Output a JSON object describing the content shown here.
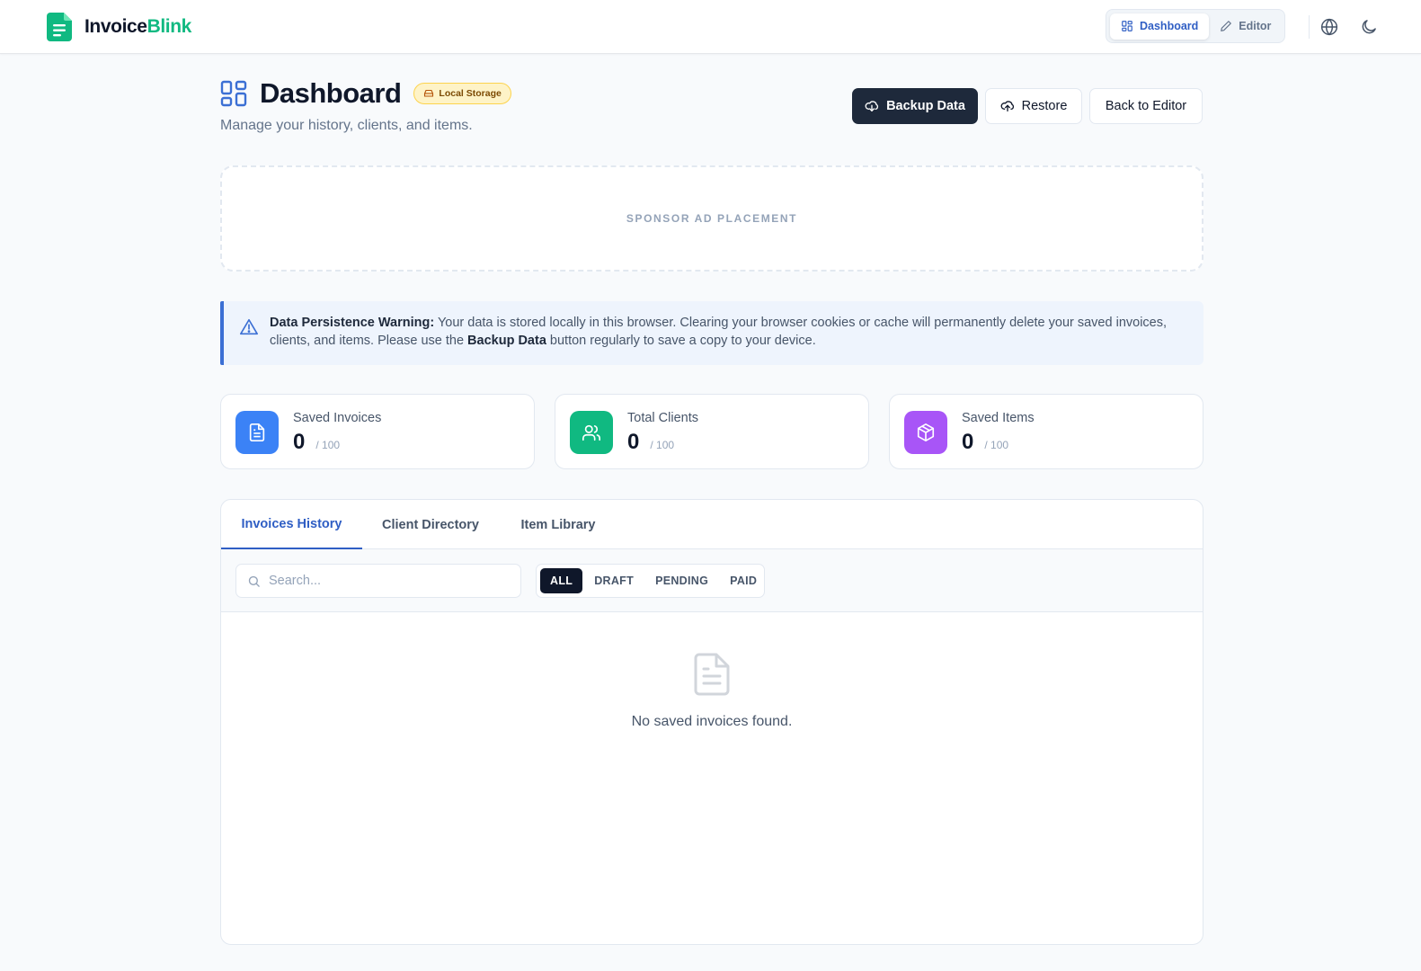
{
  "app": {
    "brand_part1": "Invoice",
    "brand_part2": "Blink",
    "nav": {
      "dashboard": "Dashboard",
      "editor": "Editor"
    }
  },
  "page": {
    "title": "Dashboard",
    "storage_badge": "Local Storage",
    "subtitle": "Manage your history, clients, and items."
  },
  "actions": {
    "backup": "Backup Data",
    "restore": "Restore",
    "back": "Back to Editor"
  },
  "ad": {
    "label": "SPONSOR AD PLACEMENT"
  },
  "warning": {
    "title": "Data Persistence Warning:",
    "text1": " Your data is stored locally in this browser. Clearing your browser cookies or cache will permanently delete your saved invoices, clients, and items. Please use the ",
    "link": "Backup Data",
    "text2": " button regularly to save a copy to your device."
  },
  "stats": [
    {
      "label": "Saved Invoices",
      "value": "0",
      "max": "/ 100",
      "icon": "file-text-icon",
      "color": "#3b82f6"
    },
    {
      "label": "Total Clients",
      "value": "0",
      "max": "/ 100",
      "icon": "users-icon",
      "color": "#10b981"
    },
    {
      "label": "Saved Items",
      "value": "0",
      "max": "/ 100",
      "icon": "package-icon",
      "color": "#a855f7"
    }
  ],
  "tabs": [
    "Invoices History",
    "Client Directory",
    "Item Library"
  ],
  "search": {
    "placeholder": "Search...",
    "value": ""
  },
  "filters": [
    "ALL",
    "DRAFT",
    "PENDING",
    "PAID"
  ],
  "active_filter": "ALL",
  "empty": {
    "text": "No saved invoices found."
  },
  "colors": {
    "accent": "#2f5ec4",
    "brand": "#10b981",
    "dark_button": "#1e293b"
  }
}
